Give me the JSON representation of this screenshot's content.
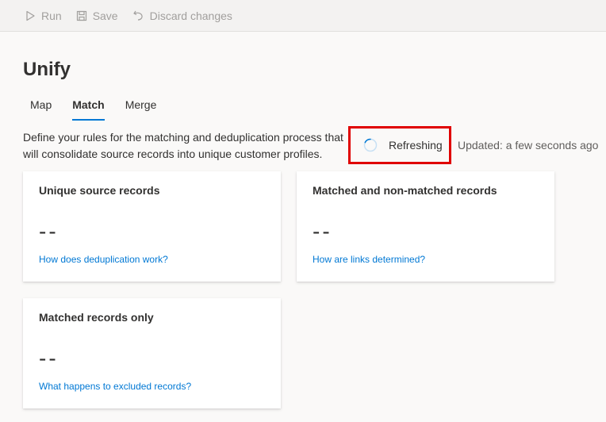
{
  "toolbar": {
    "run_label": "Run",
    "save_label": "Save",
    "discard_label": "Discard changes"
  },
  "page": {
    "title": "Unify",
    "description": "Define your rules for the matching and deduplication process that will consolidate source records into unique customer profiles."
  },
  "tabs": [
    {
      "label": "Map",
      "active": false
    },
    {
      "label": "Match",
      "active": true
    },
    {
      "label": "Merge",
      "active": false
    }
  ],
  "status": {
    "refreshing_label": "Refreshing",
    "updated_text": "Updated: a few seconds ago"
  },
  "cards": [
    {
      "title": "Unique source records",
      "value": "--",
      "link": "How does deduplication work?"
    },
    {
      "title": "Matched and non-matched records",
      "value": "--",
      "link": "How are links determined?"
    },
    {
      "title": "Matched records only",
      "value": "--",
      "link": "What happens to excluded records?"
    }
  ],
  "colors": {
    "accent": "#0078d4",
    "highlight_border": "#e00000",
    "disabled_text": "#a19f9d"
  }
}
